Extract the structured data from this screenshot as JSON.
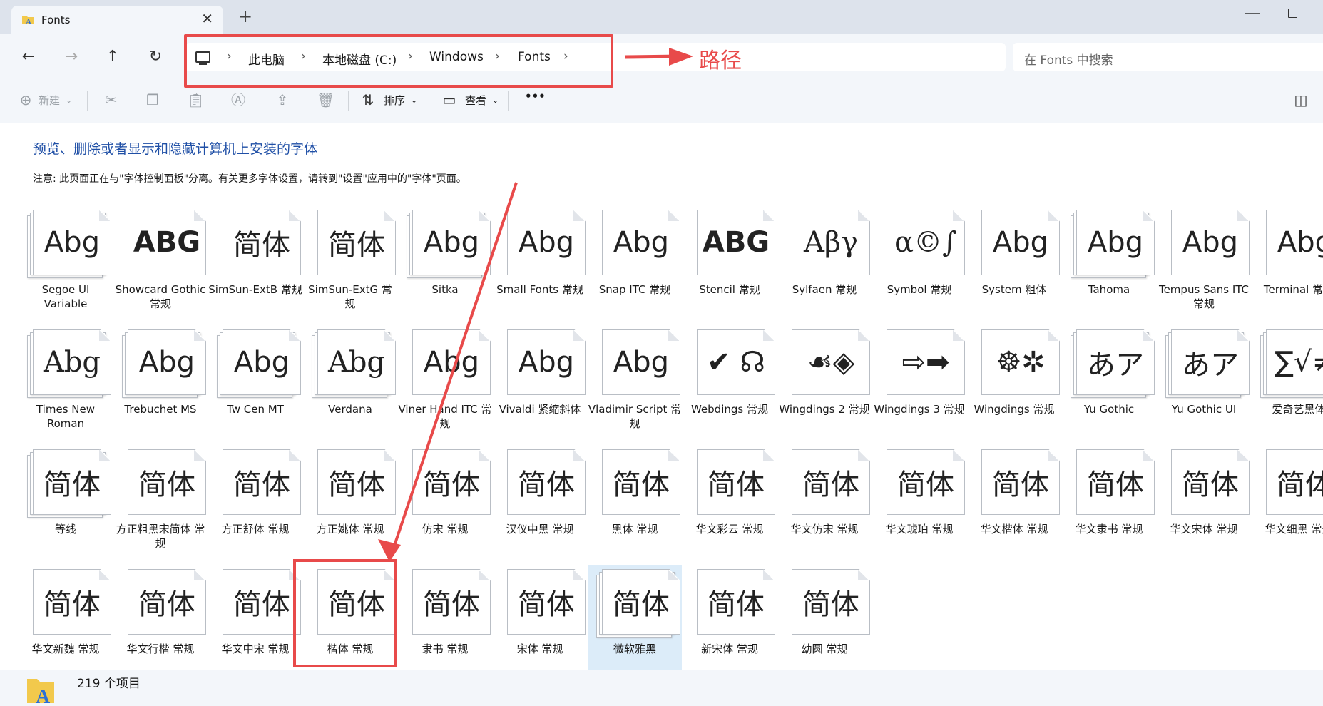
{
  "window": {
    "tab_title": "Fonts",
    "tab_close_glyph": "✕",
    "new_tab_glyph": "+",
    "minimize_glyph": "—"
  },
  "nav": {
    "back_glyph": "←",
    "forward_glyph": "→",
    "up_glyph": "↑",
    "refresh_glyph": "↻"
  },
  "breadcrumb": {
    "items": [
      "此电脑",
      "本地磁盘 (C:)",
      "Windows",
      "Fonts"
    ],
    "separator": "›"
  },
  "annotation": {
    "path_label": "路径",
    "color": "#e84a4a"
  },
  "search": {
    "placeholder": "在 Fonts 中搜索"
  },
  "commandbar": {
    "new_label": "新建",
    "sort_label": "排序",
    "view_label": "查看",
    "more_label": "•••"
  },
  "content": {
    "heading": "预览、删除或者显示和隐藏计算机上安装的字体",
    "note": "注意: 此页面正在与\"字体控制面板\"分离。有关更多字体设置，请转到\"设置\"应用中的\"字体\"页面。"
  },
  "fonts": [
    {
      "name": "Segoe UI Variable",
      "sample": "Abg",
      "stack": true
    },
    {
      "name": "Showcard Gothic 常规",
      "sample": "ABG",
      "stack": false
    },
    {
      "name": "SimSun-ExtB 常规",
      "sample": "简体",
      "stack": false
    },
    {
      "name": "SimSun-ExtG 常规",
      "sample": "简体",
      "stack": false
    },
    {
      "name": "Sitka",
      "sample": "Abg",
      "stack": true
    },
    {
      "name": "Small Fonts 常规",
      "sample": "Abg",
      "stack": false
    },
    {
      "name": "Snap ITC 常规",
      "sample": "Abg",
      "stack": false
    },
    {
      "name": "Stencil 常规",
      "sample": "ABG",
      "stack": false
    },
    {
      "name": "Sylfaen 常规",
      "sample": "Αβγ",
      "stack": false
    },
    {
      "name": "Symbol 常规",
      "sample": "α©∫",
      "stack": false
    },
    {
      "name": "System 粗体",
      "sample": "Abg",
      "stack": false
    },
    {
      "name": "Tahoma",
      "sample": "Abg",
      "stack": true
    },
    {
      "name": "Tempus Sans ITC 常规",
      "sample": "Abg",
      "stack": false
    },
    {
      "name": "Terminal 常规",
      "sample": "Abg",
      "stack": false
    },
    {
      "name": "Times New Roman",
      "sample": "Abg",
      "stack": true
    },
    {
      "name": "Trebuchet MS",
      "sample": "Abg",
      "stack": true
    },
    {
      "name": "Tw Cen MT",
      "sample": "Abg",
      "stack": true
    },
    {
      "name": "Verdana",
      "sample": "Abg",
      "stack": true
    },
    {
      "name": "Viner Hand ITC 常规",
      "sample": "Abg",
      "stack": false
    },
    {
      "name": "Vivaldi 紧缩斜体",
      "sample": "Abg",
      "stack": false
    },
    {
      "name": "Vladimir Script 常规",
      "sample": "Abg",
      "stack": false
    },
    {
      "name": "Webdings 常规",
      "sample": "✔ ☊",
      "stack": false
    },
    {
      "name": "Wingdings 2 常规",
      "sample": "☙◈",
      "stack": false
    },
    {
      "name": "Wingdings 3 常规",
      "sample": "⇨➡",
      "stack": false
    },
    {
      "name": "Wingdings 常规",
      "sample": "☸✲",
      "stack": false
    },
    {
      "name": "Yu Gothic",
      "sample": "あア",
      "stack": true
    },
    {
      "name": "Yu Gothic UI",
      "sample": "あア",
      "stack": true
    },
    {
      "name": "爱奇艺黑体",
      "sample": "∑√≠",
      "stack": true
    },
    {
      "name": "等线",
      "sample": "简体",
      "stack": true
    },
    {
      "name": "方正粗黑宋简体 常规",
      "sample": "简体",
      "stack": false
    },
    {
      "name": "方正舒体 常规",
      "sample": "简体",
      "stack": false
    },
    {
      "name": "方正姚体 常规",
      "sample": "简体",
      "stack": false
    },
    {
      "name": "仿宋 常规",
      "sample": "简体",
      "stack": false
    },
    {
      "name": "汉仪中黑 常规",
      "sample": "简体",
      "stack": false
    },
    {
      "name": "黑体 常规",
      "sample": "简体",
      "stack": false
    },
    {
      "name": "华文彩云 常规",
      "sample": "简体",
      "stack": false
    },
    {
      "name": "华文仿宋 常规",
      "sample": "简体",
      "stack": false
    },
    {
      "name": "华文琥珀 常规",
      "sample": "简体",
      "stack": false
    },
    {
      "name": "华文楷体 常规",
      "sample": "简体",
      "stack": false
    },
    {
      "name": "华文隶书 常规",
      "sample": "简体",
      "stack": false
    },
    {
      "name": "华文宋体 常规",
      "sample": "简体",
      "stack": false
    },
    {
      "name": "华文细黑 常规",
      "sample": "简体",
      "stack": false
    },
    {
      "name": "华文新魏 常规",
      "sample": "简体",
      "stack": false
    },
    {
      "name": "华文行楷 常规",
      "sample": "简体",
      "stack": false
    },
    {
      "name": "华文中宋 常规",
      "sample": "简体",
      "stack": false
    },
    {
      "name": "楷体 常规",
      "sample": "简体",
      "stack": false
    },
    {
      "name": "隶书 常规",
      "sample": "简体",
      "stack": false
    },
    {
      "name": "宋体 常规",
      "sample": "简体",
      "stack": false
    },
    {
      "name": "微软雅黑",
      "sample": "简体",
      "stack": true,
      "selected": true
    },
    {
      "name": "新宋体 常规",
      "sample": "简体",
      "stack": false
    },
    {
      "name": "幼圆 常规",
      "sample": "简体",
      "stack": false
    }
  ],
  "status": {
    "item_count": "219 个项目"
  }
}
